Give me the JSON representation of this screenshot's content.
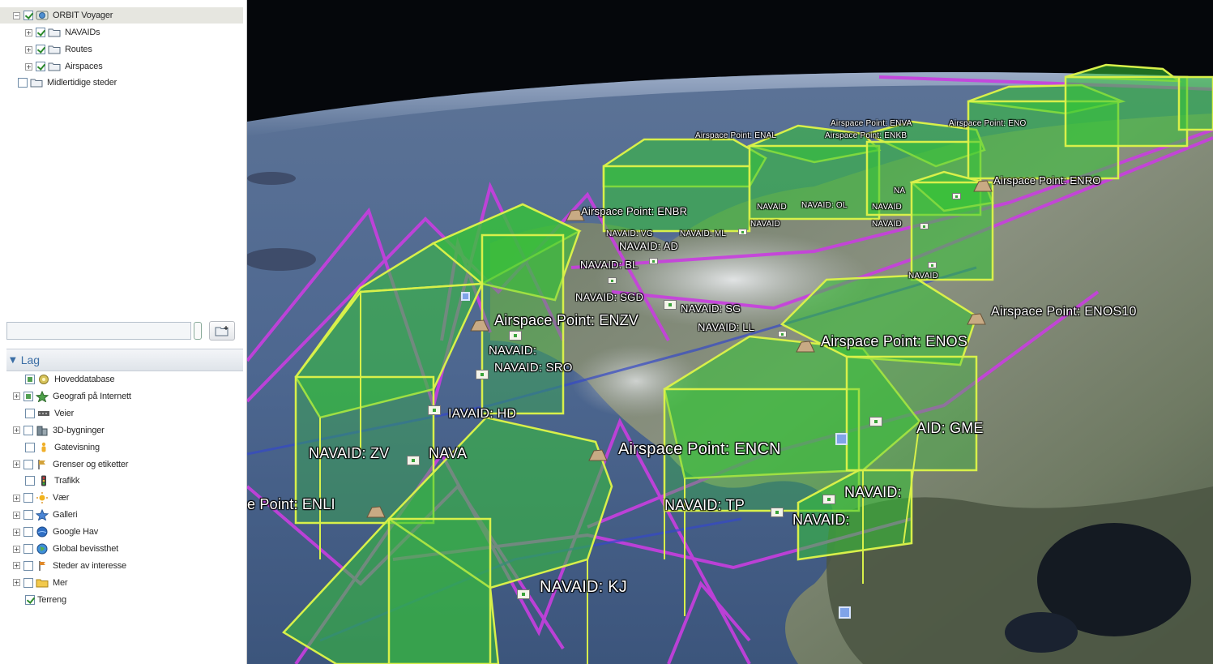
{
  "sidebar": {
    "places_tree": [
      {
        "label": "ORBIT Voyager",
        "icon": "globe-icon",
        "expand": "−",
        "check": "checked",
        "selected": true
      },
      {
        "label": "NAVAIDs",
        "icon": "folder-icon",
        "expand": "+",
        "check": "checked"
      },
      {
        "label": "Routes",
        "icon": "folder-icon",
        "expand": "+",
        "check": "checked"
      },
      {
        "label": "Airspaces",
        "icon": "folder-icon",
        "expand": "+",
        "check": "checked"
      },
      {
        "label": "Midlertidige steder",
        "icon": "folder-icon",
        "expand": "",
        "check": "unchecked"
      }
    ],
    "search": {
      "value": ""
    },
    "layers_panel": {
      "title": "Lag",
      "items": [
        {
          "label": "Hoveddatabase",
          "icon": "database-icon",
          "expand": "",
          "check": "partial"
        },
        {
          "label": "Geografi på Internett",
          "icon": "star-icon",
          "expand": "+",
          "check": "partial"
        },
        {
          "label": "Veier",
          "icon": "road-icon",
          "expand": "",
          "check": "unchecked"
        },
        {
          "label": "3D-bygninger",
          "icon": "building-icon",
          "expand": "+",
          "check": "unchecked"
        },
        {
          "label": "Gatevisning",
          "icon": "pegman-icon",
          "expand": "",
          "check": "unchecked"
        },
        {
          "label": "Grenser og etiketter",
          "icon": "flag-icon",
          "expand": "+",
          "check": "unchecked"
        },
        {
          "label": "Trafikk",
          "icon": "traffic-light-icon",
          "expand": "",
          "check": "unchecked"
        },
        {
          "label": "Vær",
          "icon": "sun-icon",
          "expand": "+",
          "check": "unchecked"
        },
        {
          "label": "Galleri",
          "icon": "star-blue-icon",
          "expand": "+",
          "check": "unchecked"
        },
        {
          "label": "Google Hav",
          "icon": "ocean-globe-icon",
          "expand": "+",
          "check": "unchecked"
        },
        {
          "label": "Global bevissthet",
          "icon": "earth-icon",
          "expand": "+",
          "check": "unchecked"
        },
        {
          "label": "Steder av interesse",
          "icon": "poi-flag-icon",
          "expand": "+",
          "check": "unchecked"
        },
        {
          "label": "Mer",
          "icon": "more-folder-icon",
          "expand": "+",
          "check": "unchecked"
        },
        {
          "label": "Terreng",
          "icon": "",
          "expand": "",
          "check": "checked"
        }
      ]
    }
  },
  "map": {
    "airspace_labels": [
      "Airspace Point: ENBR",
      "Airspace Point: ENZV",
      "Airspace Point: ENOS",
      "Airspace Point: ENOS10",
      "Airspace Point: ENCN",
      "e Point: ENLI",
      "Airspace Point: ENRO",
      "Airspace Point: ENAL",
      "Airspace Point: ENKB",
      "Airspace Point: ENVA",
      "Airspace Point: ENO"
    ],
    "navaid_labels": [
      "NAVAID: ZV",
      "NAVAID: KJ",
      "NAVAID: TP",
      "NAVAID:",
      "NAVAID:",
      "AID: GME",
      "NAVAID: SRO",
      "NAVAID:",
      "NAVAID: SGD",
      "NAVAID: SG",
      "NAVAID: LL",
      "NAVAID: BL",
      "NAVAID: AD",
      "NAVAID: VG",
      "NAVAID: ML",
      "NAVAID",
      "NAVAID: OL",
      "NAVAID",
      "NAVAID",
      "NAVAID",
      "IAVAID: HD",
      "NAVA",
      "NAVAID",
      "NA"
    ],
    "colors": {
      "airspace_fill": "#35c437",
      "airspace_edge": "#d8f04a",
      "route_line": "#c93ee0",
      "sky": "#05070b"
    }
  }
}
